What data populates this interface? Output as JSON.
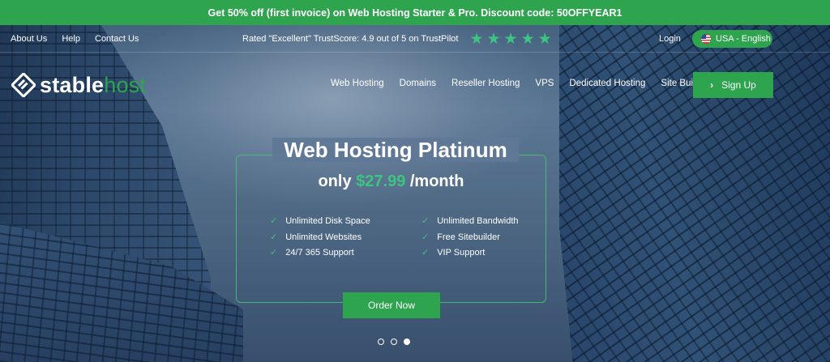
{
  "promo": {
    "text": "Get 50% off (first invoice) on Web Hosting Starter & Pro. Discount code: 50OFFYEAR1"
  },
  "topnav": {
    "links": [
      "About Us",
      "Help",
      "Contact Us"
    ],
    "trust_text": "Rated \"Excellent\" TrustScore: 4.9 out of 5 on TrustPilot",
    "stars": 5,
    "login": "Login",
    "language": "USA - English"
  },
  "brand": {
    "name_part1": "stable",
    "name_part2": "host"
  },
  "mainnav": {
    "items": [
      "Web Hosting",
      "Domains",
      "Reseller Hosting",
      "VPS",
      "Dedicated Hosting",
      "Site Builder"
    ],
    "signup": "Sign Up"
  },
  "plan": {
    "title": "Web Hosting Platinum",
    "price_prefix": "only",
    "price": "$27.99",
    "price_suffix": "/month",
    "features_left": [
      "Unlimited Disk Space",
      "Unlimited Websites",
      "24/7 365 Support"
    ],
    "features_right": [
      "Unlimited Bandwidth",
      "Free Sitebuilder",
      "VIP Support"
    ],
    "cta": "Order Now"
  },
  "carousel": {
    "slides": 3,
    "active": 3
  },
  "colors": {
    "accent": "#2ea44f",
    "star": "#3ec482"
  }
}
